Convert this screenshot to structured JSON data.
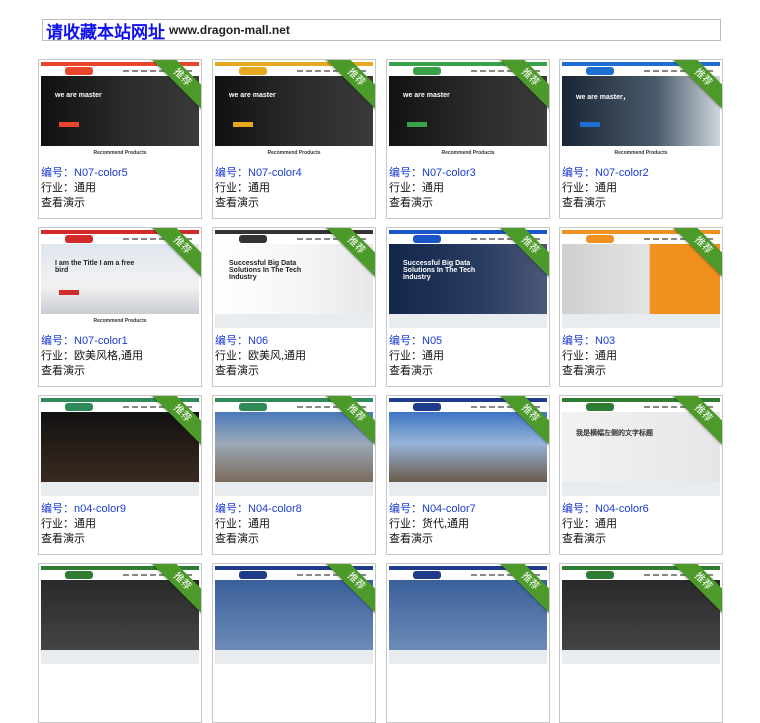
{
  "banner": {
    "big_text": "请收藏本站网址",
    "url": "www.dragon-mall.net"
  },
  "ribbon_label": "推荐",
  "cards": [
    {
      "code": "编号：N07-color5",
      "industry": "行业：通用",
      "demo": "查看演示",
      "hero_text": "we are master",
      "foot_label": "Recommend Products",
      "accent": "#e8462c"
    },
    {
      "code": "编号：N07-color4",
      "industry": "行业：通用",
      "demo": "查看演示",
      "hero_text": "we are master",
      "foot_label": "Recommend Products",
      "accent": "#e5a81e"
    },
    {
      "code": "编号：N07-color3",
      "industry": "行业：通用",
      "demo": "查看演示",
      "hero_text": "we are master",
      "foot_label": "Recommend Products",
      "accent": "#3aa04a"
    },
    {
      "code": "编号：N07-color2",
      "industry": "行业：通用",
      "demo": "查看演示",
      "hero_text": "we are master，",
      "foot_label": "Recommend Products",
      "accent": "#1e6fd0"
    },
    {
      "code": "编号：N07-color1",
      "industry": "行业：欧美风格,通用",
      "demo": "查看演示",
      "hero_text": "I am the Title I am a free bird",
      "foot_label": "Recommend Products",
      "accent": "#d02a2a"
    },
    {
      "code": "编号：N06",
      "industry": "行业：欧美风,通用",
      "demo": "查看演示",
      "hero_text": "Successful Big Data Solutions In The Tech Industry",
      "accent": "#333333"
    },
    {
      "code": "编号：N05",
      "industry": "行业：通用",
      "demo": "查看演示",
      "hero_text": "Successful Big Data Solutions In The Tech Industry",
      "accent": "#1a56c8"
    },
    {
      "code": "编号：N03",
      "industry": "行业：通用",
      "demo": "查看演示",
      "hero_text": "",
      "accent": "#f0901e"
    },
    {
      "code": "编号：n04-color9",
      "industry": "行业：通用",
      "demo": "查看演示",
      "hero_text": "",
      "accent": "#2e8b57"
    },
    {
      "code": "编号：N04-color8",
      "industry": "行业：通用",
      "demo": "查看演示",
      "hero_text": "",
      "accent": "#2e8b57"
    },
    {
      "code": "编号：N04-color7",
      "industry": "行业：货代,通用",
      "demo": "查看演示",
      "hero_text": "",
      "accent": "#1f3c88"
    },
    {
      "code": "编号：N04-color6",
      "industry": "行业：通用",
      "demo": "查看演示",
      "hero_text": "我是横幅左侧的文字标题",
      "accent": "#2e7d32"
    },
    {
      "code": "",
      "industry": "",
      "demo": "",
      "hero_text": "",
      "accent": "#2e7d32"
    },
    {
      "code": "",
      "industry": "",
      "demo": "",
      "hero_text": "",
      "accent": "#1f3c88"
    },
    {
      "code": "",
      "industry": "",
      "demo": "",
      "hero_text": "",
      "accent": "#1f3c88"
    },
    {
      "code": "",
      "industry": "",
      "demo": "",
      "hero_text": "",
      "accent": "#2e7d32"
    }
  ]
}
